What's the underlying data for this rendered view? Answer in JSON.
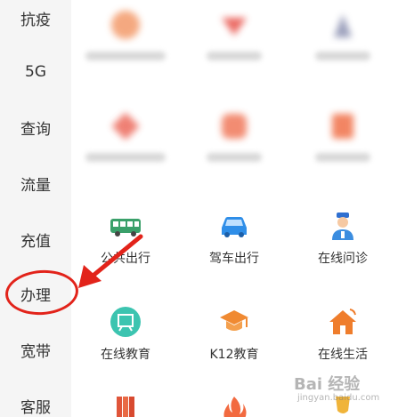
{
  "sidebar": {
    "items": [
      {
        "label": "抗疫"
      },
      {
        "label": "5G"
      },
      {
        "label": "查询"
      },
      {
        "label": "流量"
      },
      {
        "label": "充值"
      },
      {
        "label": "办理"
      },
      {
        "label": "宽带"
      },
      {
        "label": "客服"
      }
    ]
  },
  "grid": {
    "services": [
      {
        "label": "公共出行",
        "icon": "bus-icon"
      },
      {
        "label": "驾车出行",
        "icon": "car-icon"
      },
      {
        "label": "在线问诊",
        "icon": "doctor-icon"
      },
      {
        "label": "在线教育",
        "icon": "education-board-icon"
      },
      {
        "label": "K12教育",
        "icon": "graduation-cap-icon"
      },
      {
        "label": "在线生活",
        "icon": "home-wifi-icon"
      }
    ]
  },
  "watermark": {
    "brand": "Bai 经验",
    "site": "jingyan.baidu.com"
  },
  "colors": {
    "annotation_red": "#e2231a",
    "blurred_orange": "#f39a6a",
    "bus_green": "#3aa06a",
    "car_blue": "#2f8ee8",
    "edu_teal": "#3cc4b0",
    "cap_orange": "#f08a32",
    "home_orange": "#ef7d2c"
  }
}
